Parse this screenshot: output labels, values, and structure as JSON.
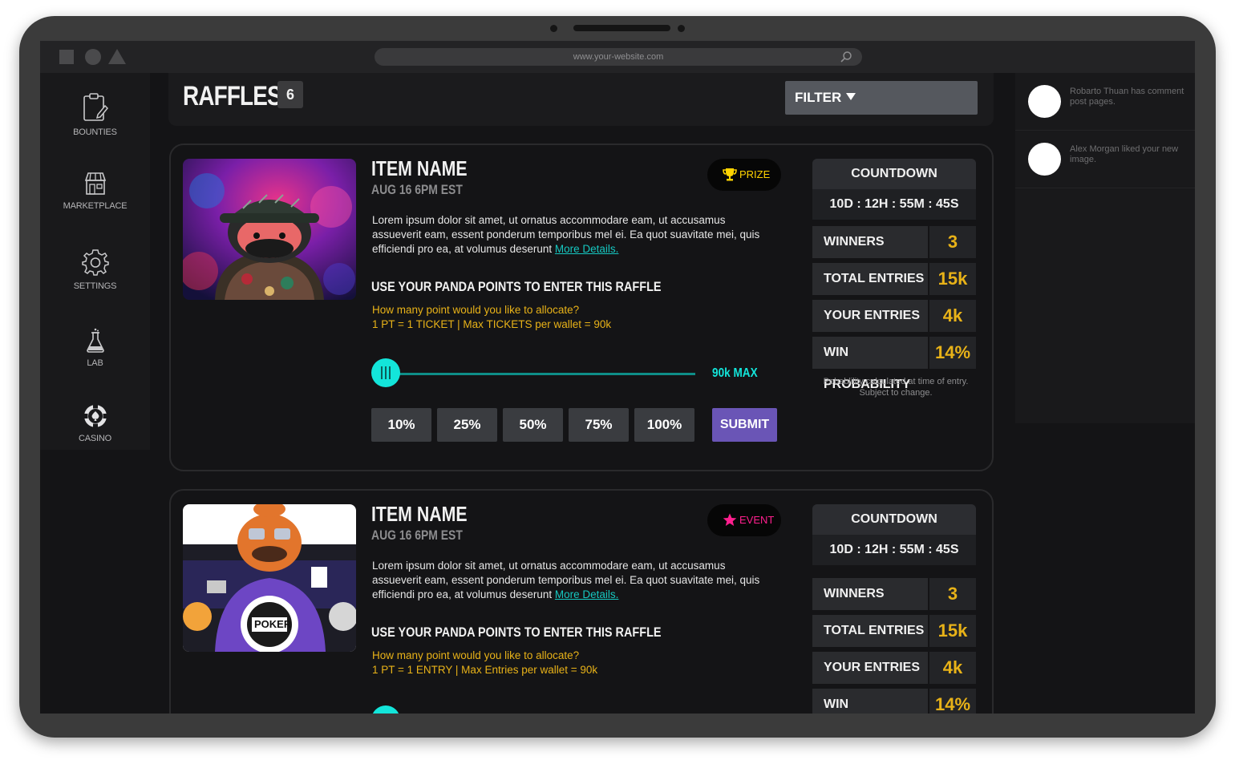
{
  "browser": {
    "url": "www.your-website.com"
  },
  "sidebar": {
    "items": [
      {
        "label": "BOUNTIES",
        "icon": "clipboard-icon"
      },
      {
        "label": "MARKETPLACE",
        "icon": "storefront-icon"
      },
      {
        "label": "SETTINGS",
        "icon": "gear-icon"
      },
      {
        "label": "LAB",
        "icon": "flask-icon"
      },
      {
        "label": "CASINO",
        "icon": "poker-chip-icon"
      }
    ]
  },
  "header": {
    "title": "RAFFLES",
    "count": "6",
    "filter_label": "FILTER"
  },
  "raffles": [
    {
      "name": "ITEM NAME",
      "date": "AUG 16 6PM EST",
      "badge": {
        "label": "PRIZE",
        "icon": "trophy-icon",
        "color": "#ffd400"
      },
      "description": "Lorem ipsum dolor sit amet, ut ornatus accommodare eam, ut accusamus assueverit eam, essent ponderum temporibus mel ei. Ea quot suavitate mei, quis efficiendi pro ea, at volumus deserunt",
      "more_link": "More Details.",
      "use_title": "USE YOUR PANDA POINTS TO ENTER THIS RAFFLE",
      "question": "How many point would you like to allocate?",
      "rule": "1 PT = 1 TICKET | Max TICKETS per wallet = 90k",
      "slider_max_label": "90k MAX",
      "slider_value": 0,
      "percent_buttons": [
        "10%",
        "25%",
        "50%",
        "75%",
        "100%"
      ],
      "submit_label": "SUBMIT",
      "countdown_label": "COUNTDOWN",
      "countdown": {
        "d": "10D",
        "h": "12H",
        "m": "55M",
        "s": "45S"
      },
      "stats": [
        {
          "label": "WINNERS",
          "value": "3"
        },
        {
          "label": "TOTAL ENTRIES",
          "value": "15k"
        },
        {
          "label": "YOUR ENTRIES",
          "value": "4k"
        },
        {
          "label": "WIN PROBABILITY",
          "value": "14%"
        }
      ],
      "probability_note": "Pobablility calculated at time of entry. Subject to change."
    },
    {
      "name": "ITEM NAME",
      "date": "AUG 16 6PM EST",
      "badge": {
        "label": "EVENT",
        "icon": "star-icon",
        "color": "#ff1f8e"
      },
      "description": "Lorem ipsum dolor sit amet, ut ornatus accommodare eam, ut accusamus assueverit eam, essent ponderum temporibus mel ei. Ea quot suavitate mei, quis efficiendi pro ea, at volumus deserunt",
      "more_link": "More Details.",
      "use_title": "USE YOUR PANDA POINTS TO ENTER THIS RAFFLE",
      "question": "How many point would you like to allocate?",
      "rule": "1 PT = 1 ENTRY | Max Entries per wallet = 90k",
      "countdown_label": "COUNTDOWN",
      "countdown": {
        "d": "10D",
        "h": "12H",
        "m": "55M",
        "s": "45S"
      },
      "stats": [
        {
          "label": "WINNERS",
          "value": "3"
        },
        {
          "label": "TOTAL ENTRIES",
          "value": "15k"
        },
        {
          "label": "YOUR ENTRIES",
          "value": "4k"
        },
        {
          "label": "WIN PROBABILITY",
          "value": "14%"
        }
      ]
    }
  ],
  "notifications": [
    {
      "text": "Robarto Thuan has comment post pages."
    },
    {
      "text": "Alex Morgan liked your new image."
    }
  ],
  "colors": {
    "accent_teal": "#13e5da",
    "accent_yellow": "#e8b218",
    "submit_purple": "#6a55b6",
    "event_pink": "#ff1f8e"
  }
}
